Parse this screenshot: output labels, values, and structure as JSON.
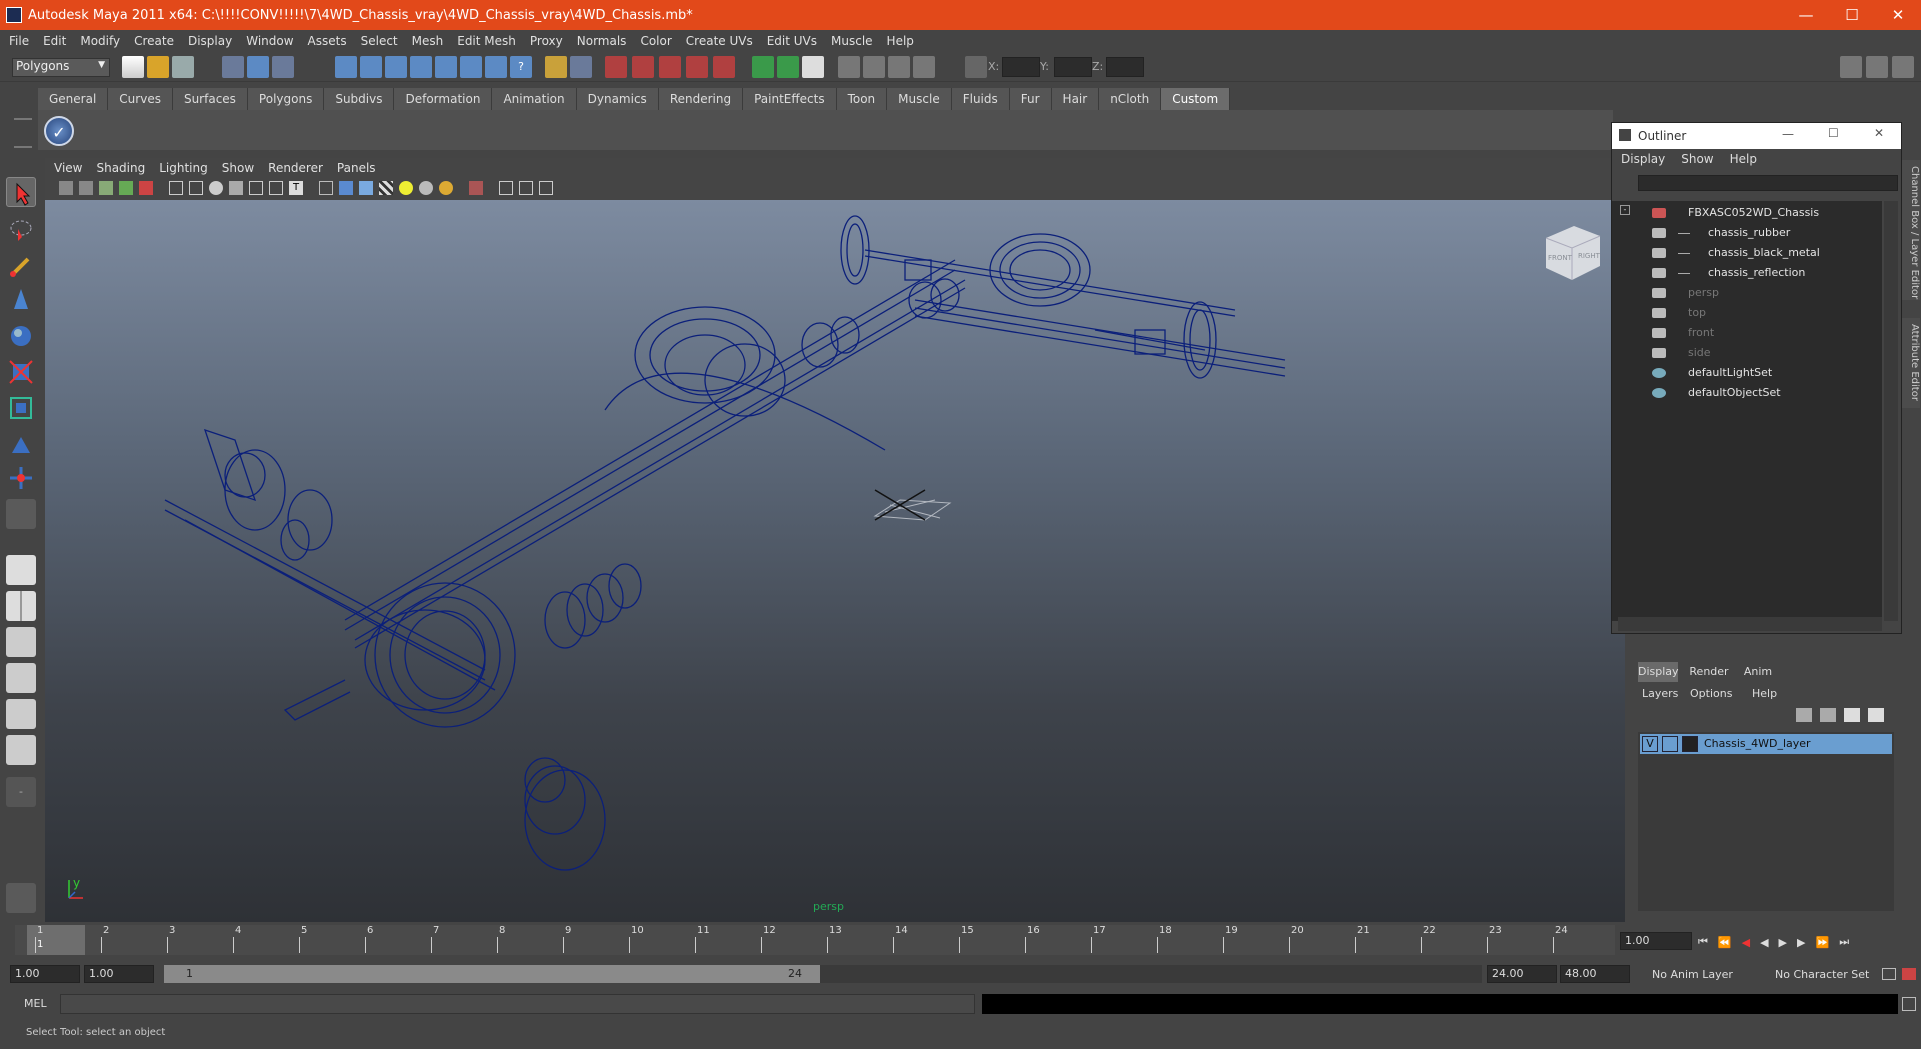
{
  "window": {
    "title": "Autodesk Maya 2011 x64: C:\\!!!!CONV!!!!!\\7\\4WD_Chassis_vray\\4WD_Chassis_vray\\4WD_Chassis.mb*"
  },
  "menu": [
    "File",
    "Edit",
    "Modify",
    "Create",
    "Display",
    "Window",
    "Assets",
    "Select",
    "Mesh",
    "Edit Mesh",
    "Proxy",
    "Normals",
    "Color",
    "Create UVs",
    "Edit UVs",
    "Muscle",
    "Help"
  ],
  "mode_selector": "Polygons",
  "xyz": {
    "x": "X:",
    "y": "Y:",
    "z": "Z:"
  },
  "shelf_tabs": [
    "General",
    "Curves",
    "Surfaces",
    "Polygons",
    "Subdivs",
    "Deformation",
    "Animation",
    "Dynamics",
    "Rendering",
    "PaintEffects",
    "Toon",
    "Muscle",
    "Fluids",
    "Fur",
    "Hair",
    "nCloth",
    "Custom"
  ],
  "active_shelf": "Custom",
  "viewport": {
    "menu": [
      "View",
      "Shading",
      "Lighting",
      "Show",
      "Renderer",
      "Panels"
    ],
    "camera_label": "persp",
    "axis_label": "y",
    "cube_front": "FRONT",
    "cube_right": "RIGHT"
  },
  "outliner": {
    "title": "Outliner",
    "menu": [
      "Display",
      "Show",
      "Help"
    ],
    "items": [
      {
        "label": "FBXASC052WD_Chassis",
        "dim": false,
        "indent": 0
      },
      {
        "label": "chassis_rubber",
        "dim": false,
        "indent": 1
      },
      {
        "label": "chassis_black_metal",
        "dim": false,
        "indent": 1
      },
      {
        "label": "chassis_reflection",
        "dim": false,
        "indent": 1
      },
      {
        "label": "persp",
        "dim": true,
        "indent": 0
      },
      {
        "label": "top",
        "dim": true,
        "indent": 0
      },
      {
        "label": "front",
        "dim": true,
        "indent": 0
      },
      {
        "label": "side",
        "dim": true,
        "indent": 0
      },
      {
        "label": "defaultLightSet",
        "dim": false,
        "indent": 0
      },
      {
        "label": "defaultObjectSet",
        "dim": false,
        "indent": 0
      }
    ]
  },
  "side_tabs": {
    "channel": "Channel Box / Layer Editor",
    "attr": "Attribute Editor"
  },
  "layer_editor": {
    "tabs": [
      "Display",
      "Render",
      "Anim"
    ],
    "menu": [
      "Layers",
      "Options",
      "Help"
    ],
    "layer_name": "Chassis_4WD_layer",
    "vis": "V"
  },
  "timeline": {
    "ticks": [
      "1",
      "2",
      "3",
      "4",
      "5",
      "6",
      "7",
      "8",
      "9",
      "10",
      "11",
      "12",
      "13",
      "14",
      "15",
      "16",
      "17",
      "18",
      "19",
      "20",
      "21",
      "22",
      "23",
      "24"
    ],
    "current": "1",
    "current_frame_field": "1.00"
  },
  "range": {
    "start": "1.00",
    "anim_start": "1.00",
    "slider_left": "1",
    "slider_right": "24",
    "end": "24.00",
    "anim_end": "48.00",
    "anim_layer": "No Anim Layer",
    "char_set": "No Character Set"
  },
  "mel": {
    "label": "MEL"
  },
  "help_line": "Select Tool: select an object",
  "colors": {
    "title_bar": "#e2491a",
    "wireframe": "#0b1f7a",
    "selected_layer": "#6a9ed0"
  }
}
